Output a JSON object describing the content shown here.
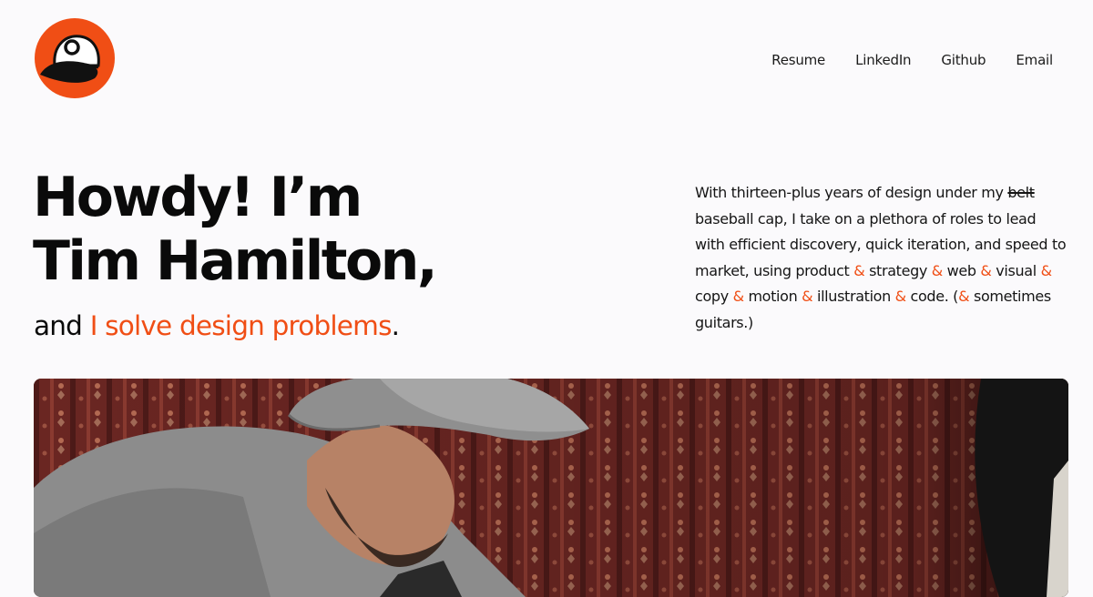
{
  "brand": {
    "logo_icon": "baseball-cap-avatar-icon",
    "colors": {
      "accent": "#f04e15",
      "text": "#0a0a0a",
      "background": "#fbfafc"
    }
  },
  "nav": {
    "items": [
      {
        "label": "Resume"
      },
      {
        "label": "LinkedIn"
      },
      {
        "label": "Github"
      },
      {
        "label": "Email"
      }
    ]
  },
  "hero": {
    "headline_line1": "Howdy! I’m",
    "headline_line2": "Tim Hamilton,",
    "tagline_prefix": "and ",
    "tagline_highlight": "I solve design problems",
    "tagline_suffix": "."
  },
  "intro": {
    "t1": "With thirteen-plus years of design under my ",
    "strike": "belt",
    "t2": " baseball cap, I take on a plethora of roles to lead with efficient discovery, quick iteration, and speed to market, using product ",
    "amp": "&",
    "t3": " strategy ",
    "t4": " web ",
    "t5": " visual ",
    "t6": " copy ",
    "t7": " motion ",
    "t8": " illustration ",
    "t9": " code. (",
    "t10": " sometimes guitars.)"
  },
  "photo": {
    "subject": "man-in-grey-baseball-cap-photo"
  }
}
